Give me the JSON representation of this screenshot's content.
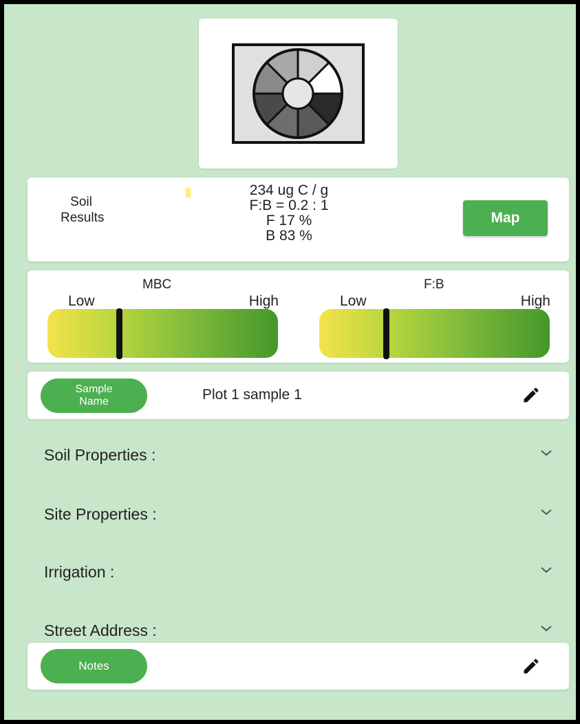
{
  "header": {
    "logo_icon": "soil-wheel-logo"
  },
  "results": {
    "label": "Soil\nResults",
    "label_line1": "Soil",
    "label_line2": "Results",
    "mbc_value": "234 ug C / g",
    "fb_ratio": "F:B = 0.2 : 1",
    "fungi_pct": "F 17 %",
    "bacteria_pct": "B 83 %",
    "map_label": "Map"
  },
  "gauges": [
    {
      "title": "MBC",
      "low": "Low",
      "high": "High",
      "level": 0.31
    },
    {
      "title": "F:B",
      "low": "Low",
      "high": "High",
      "level": 0.29
    }
  ],
  "sample": {
    "pill_line1": "Sample",
    "pill_line2": "Name",
    "value": "Plot 1 sample 1",
    "edit_icon": "pencil-icon"
  },
  "sections": [
    {
      "label": "Soil Properties :",
      "icon": "chevron-down-icon"
    },
    {
      "label": "Site Properties :",
      "icon": "chevron-down-icon"
    },
    {
      "label": "Irrigation :",
      "icon": "chevron-down-icon"
    },
    {
      "label": "Street Address :",
      "icon": "chevron-down-icon"
    }
  ],
  "notes": {
    "pill_label": "Notes",
    "edit_icon": "pencil-icon"
  },
  "colors": {
    "accent": "#4caf50",
    "background": "#c8e6c9",
    "gauge_low": "#f3e34a",
    "gauge_high": "#45972a"
  }
}
